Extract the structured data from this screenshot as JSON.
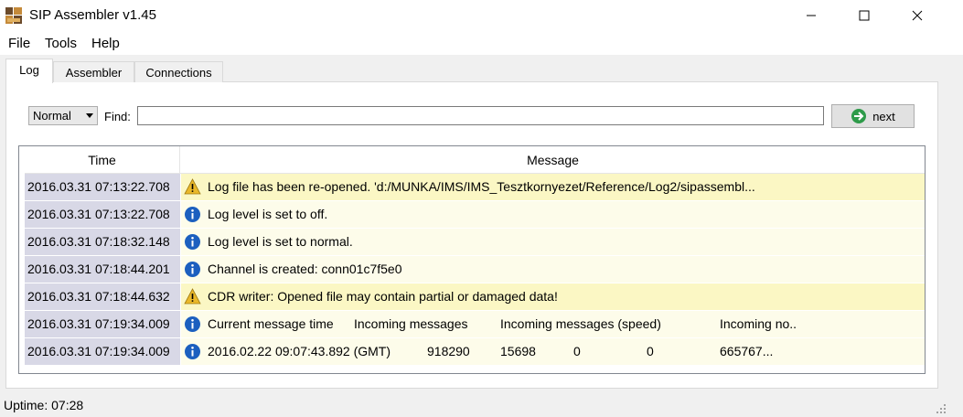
{
  "window": {
    "title": "SIP Assembler v1.45",
    "icon": "sip-app-icon"
  },
  "menu": {
    "file": "File",
    "tools": "Tools",
    "help": "Help"
  },
  "tabs": [
    {
      "label": "Log",
      "active": true
    },
    {
      "label": "Assembler",
      "active": false
    },
    {
      "label": "Connections",
      "active": false
    }
  ],
  "search": {
    "level": "Normal",
    "find_label": "Find:",
    "find_value": "",
    "next_label": "next"
  },
  "table": {
    "columns": {
      "time": "Time",
      "message": "Message"
    },
    "rows": [
      {
        "time": "2016.03.31 07:13:22.708",
        "type": "warning",
        "icon": "warning-icon",
        "message": "Log file has been re-opened. 'd:/MUNKA/IMS/IMS_Tesztkornyezet/Reference/Log2/sipassembl..."
      },
      {
        "time": "2016.03.31 07:13:22.708",
        "type": "info",
        "icon": "info-icon",
        "message": "Log level is set to off."
      },
      {
        "time": "2016.03.31 07:18:32.148",
        "type": "info",
        "icon": "info-icon",
        "message": "Log level is set to normal."
      },
      {
        "time": "2016.03.31 07:18:44.201",
        "type": "info",
        "icon": "info-icon",
        "message": "Channel is created: conn01c7f5e0"
      },
      {
        "time": "2016.03.31 07:18:44.632",
        "type": "warning",
        "icon": "warning-icon",
        "message": "CDR writer: Opened file may contain partial or damaged data!"
      },
      {
        "time": "2016.03.31 07:19:34.009",
        "type": "info",
        "icon": "info-icon",
        "segments": [
          "Current message time",
          "Incoming messages",
          "Incoming messages (speed)",
          "Incoming no.."
        ]
      },
      {
        "time": "2016.03.31 07:19:34.009",
        "type": "info",
        "icon": "info-icon",
        "segments": [
          "2016.02.22 09:07:43.892 (GMT)",
          "918290",
          "15698",
          "0",
          "0",
          "665767..."
        ]
      }
    ]
  },
  "status": {
    "uptime": "Uptime: 07:28"
  },
  "colors": {
    "warning_row": "#fbf7c4",
    "info_row": "#fdfcea",
    "time_cell": "#d8d8e6",
    "info_icon": "#1c5fbf",
    "warning_icon": "#e9b82a",
    "next_icon": "#2e9b4a"
  }
}
